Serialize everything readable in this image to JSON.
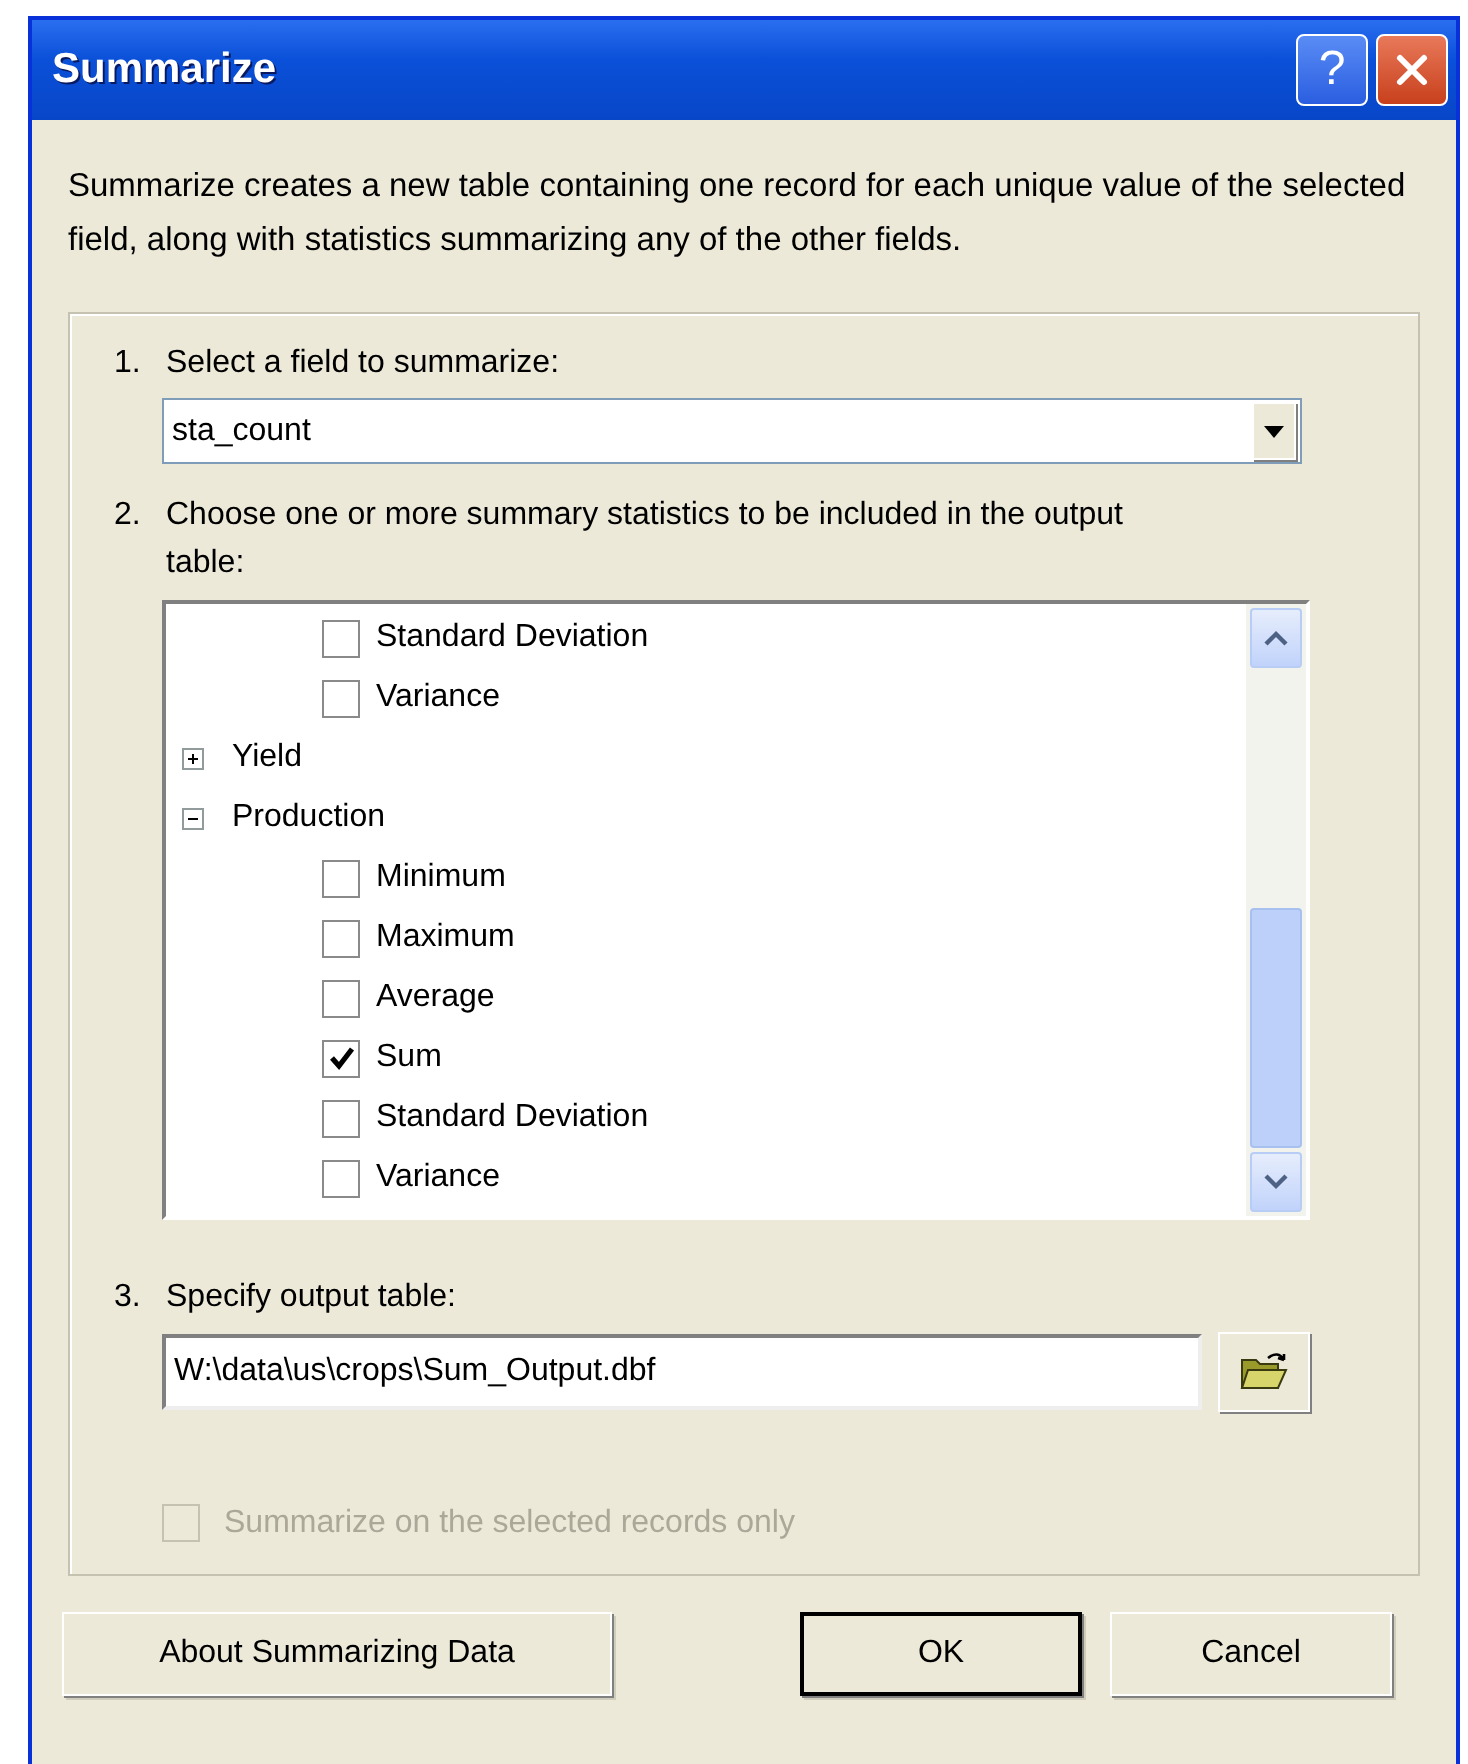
{
  "window": {
    "title": "Summarize",
    "buttons": [
      {
        "kind": "help",
        "label": "?"
      },
      {
        "kind": "close"
      }
    ]
  },
  "description": "Summarize creates a new table containing one record for each unique value of the selected field, along with statistics summarizing any of the other fields.",
  "step1": {
    "number": "1.",
    "label": "Select a field to summarize:",
    "value": "sta_count"
  },
  "step2": {
    "number": "2.",
    "label": "Choose one or more summary statistics to be included in the output table:",
    "tree": [
      {
        "children": [
          {
            "label": "Standard Deviation",
            "checked": false
          },
          {
            "label": "Variance",
            "checked": false
          }
        ]
      },
      {
        "label": "Yield",
        "expanded": false
      },
      {
        "label": "Production",
        "expanded": true,
        "children": [
          {
            "label": "Minimum",
            "checked": false
          },
          {
            "label": "Maximum",
            "checked": false
          },
          {
            "label": "Average",
            "checked": false
          },
          {
            "label": "Sum",
            "checked": true
          },
          {
            "label": "Standard Deviation",
            "checked": false
          },
          {
            "label": "Variance",
            "checked": false
          }
        ]
      }
    ]
  },
  "step3": {
    "number": "3.",
    "label": "Specify output table:",
    "value": "W:\\data\\us\\crops\\Sum_Output.dbf"
  },
  "selected_only": {
    "label": "Summarize on the selected records only",
    "checked": false,
    "disabled": true
  },
  "buttons": [
    {
      "label": "About Summarizing Data",
      "default": false
    },
    {
      "label": "OK",
      "default": true
    },
    {
      "label": "Cancel",
      "default": false
    }
  ]
}
